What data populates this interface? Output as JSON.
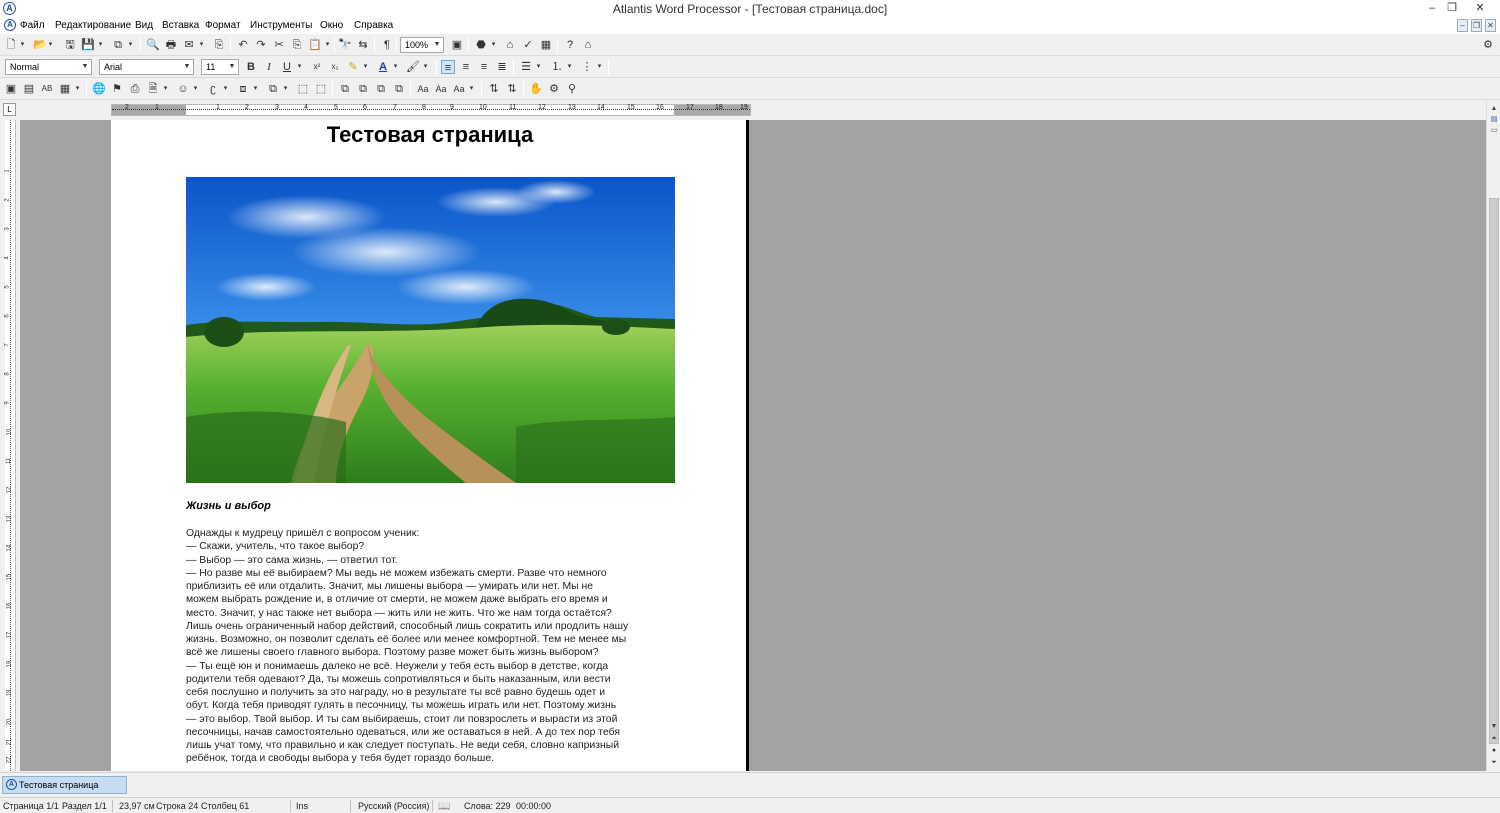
{
  "window": {
    "title": "Atlantis Word Processor - [Тестовая страница.doc]",
    "app_icon": "atlantis-logo-icon",
    "controls": {
      "minimize": "–",
      "restore": "❐",
      "close": "✕"
    }
  },
  "menu": {
    "items": [
      "Файл",
      "Редактирование",
      "Вид",
      "Вставка",
      "Формат",
      "Инструменты",
      "Окно",
      "Справка"
    ]
  },
  "formatting": {
    "style": "Normal",
    "font": "Arial",
    "size": "11",
    "bold": "B",
    "italic": "I",
    "underline": "U",
    "superscript": "x²",
    "subscript": "x₂"
  },
  "standard_toolbar": {
    "zoom": "100%",
    "pilcrow": "¶"
  },
  "ruler": {
    "numbers": [
      "2",
      "1",
      "1",
      "2",
      "3",
      "4",
      "5",
      "6",
      "7",
      "8",
      "9",
      "10",
      "11",
      "12",
      "13",
      "14",
      "15",
      "16",
      "17",
      "18",
      "19"
    ],
    "vertical_numbers": [
      "1",
      "2",
      "3",
      "4",
      "5",
      "6",
      "7",
      "8",
      "9",
      "10",
      "11",
      "12",
      "13",
      "14",
      "15",
      "16",
      "17",
      "18",
      "19",
      "20",
      "21",
      "22"
    ],
    "corner": "L"
  },
  "document": {
    "heading": "Тестовая страница",
    "subtitle": "Жизнь и выбор",
    "lines": [
      "Однажды к мудрецу пришёл с вопросом ученик:",
      "— Скажи, учитель, что такое выбор?",
      "— Выбор — это сама жизнь, — ответил тот.",
      "— Но разве мы её выбираем? Мы ведь не можем избежать смерти. Разве что немного",
      "приблизить её или отдалить. Значит, мы лишены выбора — умирать или нет. Мы не",
      "можем выбрать рождение и, в отличие от смерти, не можем даже выбрать его время и",
      "место. Значит, у нас также нет выбора — жить или не жить. Что же нам тогда остаётся?",
      "Лишь очень ограниченный набор действий, способный лишь сократить или продлить нашу",
      "жизнь. Возможно, он позволит сделать её более или менее комфортной. Тем не менее мы",
      "всё же лишены своего главного выбора. Поэтому разве может быть жизнь выбором?",
      "— Ты ещё юн и понимаешь далеко не всё. Неужели у тебя есть выбор в детстве, когда",
      "родители тебя одевают? Да, ты можешь сопротивляться и быть наказанным, или вести",
      "себя послушно и получить за это награду, но в результате ты всё равно будешь одет и",
      "обут. Когда тебя приводят гулять в песочницу, ты можешь играть или нет. Поэтому жизнь",
      "— это выбор. Твой выбор. И ты сам выбираешь, стоит ли повзрослеть и вырасти из этой",
      "песочницы, начав самостоятельно одеваться, или же оставаться в ней. А до тех пор тебя",
      "лишь учат тому, что правильно и как следует поступать. Не веди себя, словно капризный",
      "ребёнок, тогда и свободы выбора у тебя будет гораздо больше."
    ]
  },
  "task_tab": {
    "label": "Тестовая страница"
  },
  "status": {
    "page": "Страница 1/1",
    "section": "Раздел 1/1",
    "position": "23,97 см",
    "line": "Строка 24",
    "column": "Столбец 61",
    "mode": "Ins",
    "language": "Русский (Россия)",
    "words": "Слова: 229",
    "time": "00:00:00"
  },
  "colors": {
    "page_background": "#a3a3a3",
    "page": "#ffffff",
    "sky": "#1e6fd9",
    "grass": "#3f9e2b",
    "path": "#c9a36a",
    "accent": "#2050a0"
  }
}
